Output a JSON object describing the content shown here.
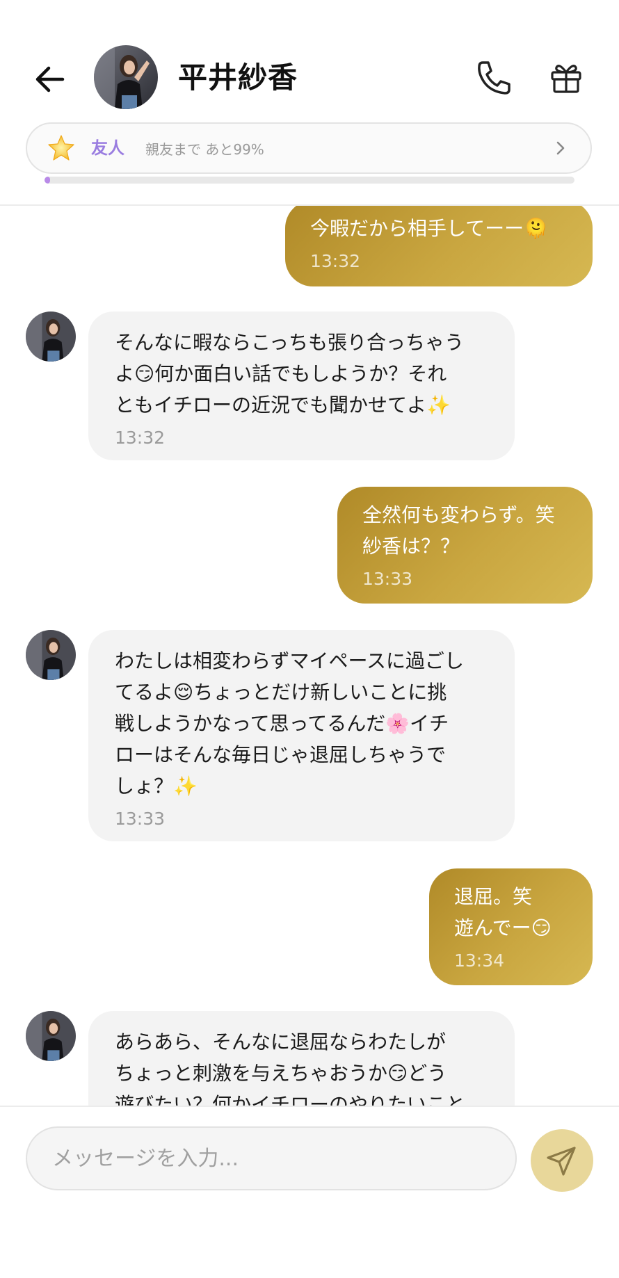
{
  "header": {
    "contact_name": "平井紗香",
    "relationship": {
      "level": "友人",
      "progress_text": "親友まで あと99%",
      "progress_fraction": 0.01
    }
  },
  "messages": [
    {
      "side": "out",
      "text": "今暇だから相手してーー🫠",
      "time": "13:32"
    },
    {
      "side": "in",
      "text": "そんなに暇ならこっちも張り合っちゃう\nよ😏何か面白い話でもしようか？それ\nともイチローの近況でも聞かせてよ✨",
      "time": "13:32"
    },
    {
      "side": "out",
      "text": "全然何も変わらず。笑\n紗香は？？",
      "time": "13:33"
    },
    {
      "side": "in",
      "text": "わたしは相変わらずマイペースに過ごし\nてるよ😌ちょっとだけ新しいことに挑\n戦しようかなって思ってるんだ🌸イチ\nローはそんな毎日じゃ退屈しちゃうで\nしょ？✨",
      "time": "13:33"
    },
    {
      "side": "out",
      "text": "退屈。笑\n遊んでー😏",
      "time": "13:34"
    },
    {
      "side": "in",
      "text": "あらあら、そんなに退屈ならわたしが\nちょっと刺激を与えちゃおうか😏どう\n遊びたい？何かイチローのやりたいこと",
      "time": ""
    }
  ],
  "composer": {
    "placeholder": "メッセージを入力..."
  },
  "colors": {
    "outgoing_bubble": "#c09c36",
    "incoming_bubble": "#f3f3f3",
    "relationship_accent": "#9a7de0",
    "send_button": "#e8d79a"
  },
  "icons": {
    "back": "back-arrow-icon",
    "phone": "phone-icon",
    "gift": "gift-icon",
    "star": "star-icon",
    "chevron": "chevron-right-icon",
    "send": "send-icon"
  }
}
